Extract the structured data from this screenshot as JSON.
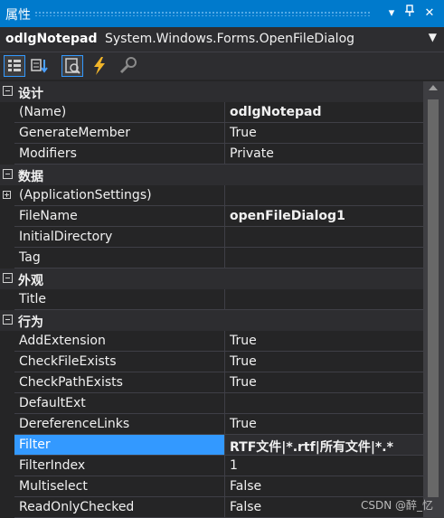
{
  "panel": {
    "title": "属性"
  },
  "object": {
    "name": "odlgNotepad",
    "type": "System.Windows.Forms.OpenFileDialog"
  },
  "toolbar": {
    "tools": [
      {
        "icon": "categorized-icon",
        "active": true
      },
      {
        "icon": "alphabetical-icon",
        "active": false
      },
      {
        "icon": "properties-icon",
        "active": true
      },
      {
        "icon": "events-icon",
        "active": false
      },
      {
        "icon": "property-pages-icon",
        "active": false
      }
    ]
  },
  "grid": {
    "categories": [
      {
        "label": "设计",
        "props": [
          {
            "name": "(Name)",
            "value": "odlgNotepad",
            "bold": true
          },
          {
            "name": "GenerateMember",
            "value": "True"
          },
          {
            "name": "Modifiers",
            "value": "Private"
          }
        ]
      },
      {
        "label": "数据",
        "props": [
          {
            "name": "(ApplicationSettings)",
            "value": "",
            "expandable": true
          },
          {
            "name": "FileName",
            "value": "openFileDialog1",
            "bold": true
          },
          {
            "name": "InitialDirectory",
            "value": ""
          },
          {
            "name": "Tag",
            "value": ""
          }
        ]
      },
      {
        "label": "外观",
        "props": [
          {
            "name": "Title",
            "value": ""
          }
        ]
      },
      {
        "label": "行为",
        "props": [
          {
            "name": "AddExtension",
            "value": "True"
          },
          {
            "name": "CheckFileExists",
            "value": "True"
          },
          {
            "name": "CheckPathExists",
            "value": "True"
          },
          {
            "name": "DefaultExt",
            "value": ""
          },
          {
            "name": "DereferenceLinks",
            "value": "True"
          },
          {
            "name": "Filter",
            "value": "RTF文件|*.rtf|所有文件|*.*",
            "bold": true,
            "selected": true
          },
          {
            "name": "FilterIndex",
            "value": "1"
          },
          {
            "name": "Multiselect",
            "value": "False"
          },
          {
            "name": "ReadOnlyChecked",
            "value": "False"
          }
        ]
      }
    ]
  },
  "watermark": "CSDN @醉_忆",
  "colors": {
    "accent": "#007acc",
    "selection": "#3399ff",
    "background": "#252526"
  }
}
